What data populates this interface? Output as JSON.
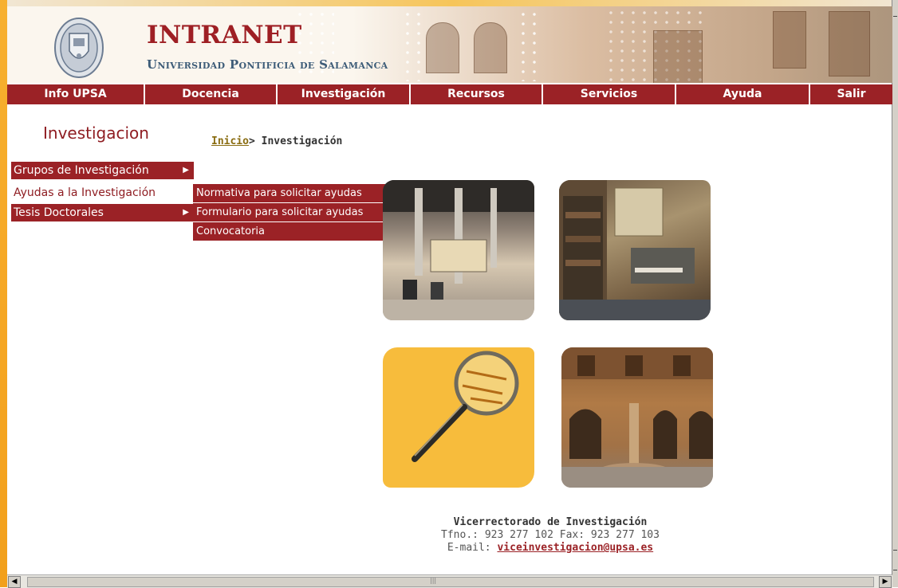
{
  "header": {
    "title": "INTRANET",
    "subtitle": "Universidad Pontificia de Salamanca"
  },
  "nav": {
    "items": [
      {
        "label": "Info UPSA"
      },
      {
        "label": "Docencia"
      },
      {
        "label": "Investigación"
      },
      {
        "label": "Recursos"
      },
      {
        "label": "Servicios"
      },
      {
        "label": "Ayuda"
      },
      {
        "label": "Salir"
      }
    ]
  },
  "section": {
    "title": "Investigacion"
  },
  "breadcrumb": {
    "home": "Inicio",
    "separator": ">",
    "current": "Investigación"
  },
  "sidebar": {
    "items": [
      {
        "label": "Grupos de Investigación",
        "has_submenu": true
      },
      {
        "label": "Ayudas a la Investigación",
        "has_submenu": false
      },
      {
        "label": "Tesis Doctorales",
        "has_submenu": true
      }
    ]
  },
  "submenu": {
    "items": [
      {
        "label": "Normativa para solicitar ayudas"
      },
      {
        "label": "Formulario para solicitar ayudas"
      },
      {
        "label": "Convocatoria"
      }
    ]
  },
  "footer": {
    "office": "Vicerrectorado de Investigación",
    "phone_line": "Tfno.: 923 277 102 Fax: 923 277 103",
    "email_label": "E-mail:",
    "email": "viceinvestigacion@upsa.es"
  },
  "colors": {
    "brand_red": "#9b2226",
    "title_red": "#9e1f24",
    "subtitle_blue": "#3d5c78",
    "frame_orange": "#f5a623",
    "magnifier_yellow": "#f7bc3c"
  }
}
